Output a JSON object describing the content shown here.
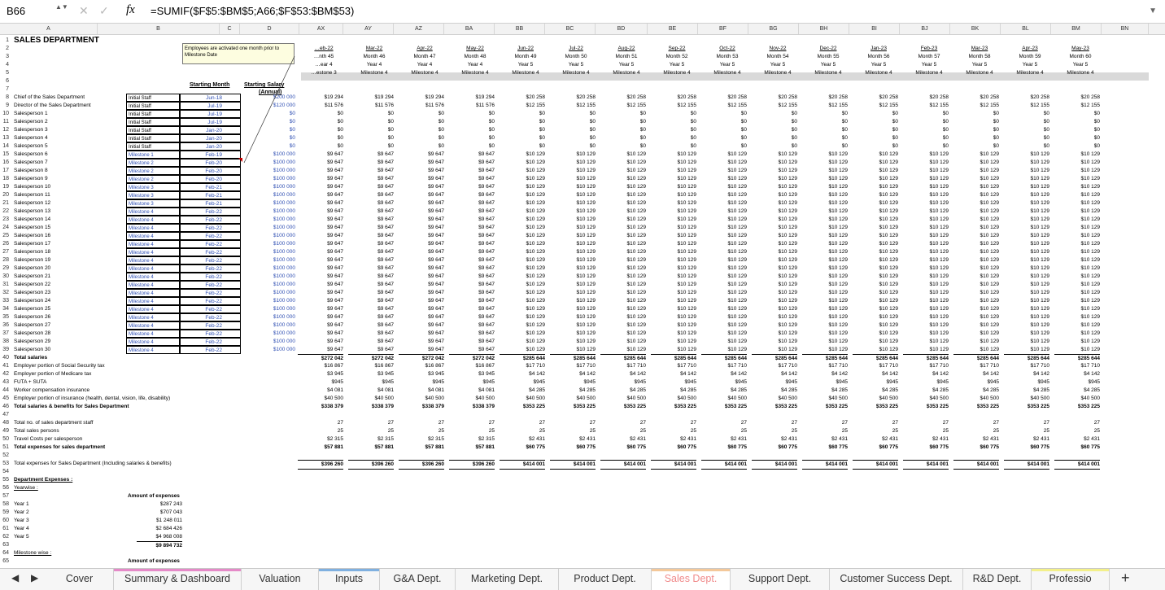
{
  "formula_bar": {
    "cell_ref": "B66",
    "fx": "fx",
    "formula": "=SUMIF($F$5:$BM$5;A66;$F$53:$BM$53)",
    "cancel": "✕",
    "confirm": "✓",
    "spin": "▲▼",
    "dropdown": "▼"
  },
  "columns": [
    "A",
    "B",
    "C",
    "D",
    "AX",
    "AY",
    "AZ",
    "BA",
    "BB",
    "BC",
    "BD",
    "BE",
    "BF",
    "BG",
    "BH",
    "BI",
    "BJ",
    "BK",
    "BL",
    "BM",
    "BN"
  ],
  "title": "SALES DEPARTMENT",
  "note": "Employees are activated one month prior to Milestone Date",
  "headers": {
    "starting_month": "Starting Month",
    "starting_salary": "Starting Salary",
    "annual": "(Annual)"
  },
  "months": [
    {
      "m": "…eb-22",
      "n": "…nth 45",
      "y": "…ear 4",
      "s": "…estone 3"
    },
    {
      "m": "Mar-22",
      "n": "Month 46",
      "y": "Year 4",
      "s": "Milestone 4"
    },
    {
      "m": "Apr-22",
      "n": "Month 47",
      "y": "Year 4",
      "s": "Milestone 4"
    },
    {
      "m": "May-22",
      "n": "Month 48",
      "y": "Year 4",
      "s": "Milestone 4"
    },
    {
      "m": "Jun-22",
      "n": "Month 49",
      "y": "Year 5",
      "s": "Milestone 4"
    },
    {
      "m": "Jul-22",
      "n": "Month 50",
      "y": "Year 5",
      "s": "Milestone 4"
    },
    {
      "m": "Aug-22",
      "n": "Month 51",
      "y": "Year 5",
      "s": "Milestone 4"
    },
    {
      "m": "Sep-22",
      "n": "Month 52",
      "y": "Year 5",
      "s": "Milestone 4"
    },
    {
      "m": "Oct-22",
      "n": "Month 53",
      "y": "Year 5",
      "s": "Milestone 4"
    },
    {
      "m": "Nov-22",
      "n": "Month 54",
      "y": "Year 5",
      "s": "Milestone 4"
    },
    {
      "m": "Dec-22",
      "n": "Month 55",
      "y": "Year 5",
      "s": "Milestone 4"
    },
    {
      "m": "Jan-23",
      "n": "Month 56",
      "y": "Year 5",
      "s": "Milestone 4"
    },
    {
      "m": "Feb-23",
      "n": "Month 57",
      "y": "Year 5",
      "s": "Milestone 4"
    },
    {
      "m": "Mar-23",
      "n": "Month 58",
      "y": "Year 5",
      "s": "Milestone 4"
    },
    {
      "m": "Apr-23",
      "n": "Month 59",
      "y": "Year 5",
      "s": "Milestone 4"
    },
    {
      "m": "May-23",
      "n": "Month 60",
      "y": "Year 5",
      "s": "Milestone 4"
    }
  ],
  "staff": [
    {
      "label": "Chief of the Sales Department",
      "cat": "Initial Staff",
      "date": "Jun-18",
      "sal": "$200 000",
      "yr4": "$19 294",
      "yr5": "$20 258"
    },
    {
      "label": "Director of the Sales Department",
      "cat": "Initial Staff",
      "date": "Jul-19",
      "sal": "$120 000",
      "yr4": "$11 576",
      "yr5": "$12 155"
    },
    {
      "label": "Salesperson 1",
      "cat": "Initial Staff",
      "date": "Jul-19",
      "sal": "$0",
      "yr4": "$0",
      "yr5": "$0"
    },
    {
      "label": "Salesperson 2",
      "cat": "Initial Staff",
      "date": "Jul-19",
      "sal": "$0",
      "yr4": "$0",
      "yr5": "$0"
    },
    {
      "label": "Salesperson 3",
      "cat": "Initial Staff",
      "date": "Jan-20",
      "sal": "$0",
      "yr4": "$0",
      "yr5": "$0"
    },
    {
      "label": "Salesperson 4",
      "cat": "Initial Staff",
      "date": "Jan-20",
      "sal": "$0",
      "yr4": "$0",
      "yr5": "$0"
    },
    {
      "label": "Salesperson 5",
      "cat": "Initial Staff",
      "date": "Jan-20",
      "sal": "$0",
      "yr4": "$0",
      "yr5": "$0"
    },
    {
      "label": "Salesperson 6",
      "cat": "Milestone 1",
      "date": "Feb-19",
      "sal": "$100 000",
      "yr4": "$9 647",
      "yr5": "$10 129"
    },
    {
      "label": "Salesperson 7",
      "cat": "Milestone 2",
      "date": "Feb-20",
      "sal": "$100 000",
      "yr4": "$9 647",
      "yr5": "$10 129"
    },
    {
      "label": "Salesperson 8",
      "cat": "Milestone 2",
      "date": "Feb-20",
      "sal": "$100 000",
      "yr4": "$9 647",
      "yr5": "$10 129"
    },
    {
      "label": "Salesperson 9",
      "cat": "Milestone 2",
      "date": "Feb-20",
      "sal": "$100 000",
      "yr4": "$9 647",
      "yr5": "$10 129"
    },
    {
      "label": "Salesperson 10",
      "cat": "Milestone 3",
      "date": "Feb-21",
      "sal": "$100 000",
      "yr4": "$9 647",
      "yr5": "$10 129"
    },
    {
      "label": "Salesperson 11",
      "cat": "Milestone 3",
      "date": "Feb-21",
      "sal": "$100 000",
      "yr4": "$9 647",
      "yr5": "$10 129"
    },
    {
      "label": "Salesperson 12",
      "cat": "Milestone 3",
      "date": "Feb-21",
      "sal": "$100 000",
      "yr4": "$9 647",
      "yr5": "$10 129"
    },
    {
      "label": "Salesperson 13",
      "cat": "Milestone 4",
      "date": "Feb-22",
      "sal": "$100 000",
      "yr4": "$9 647",
      "yr5": "$10 129"
    },
    {
      "label": "Salesperson 14",
      "cat": "Milestone 4",
      "date": "Feb-22",
      "sal": "$100 000",
      "yr4": "$9 647",
      "yr5": "$10 129"
    },
    {
      "label": "Salesperson 15",
      "cat": "Milestone 4",
      "date": "Feb-22",
      "sal": "$100 000",
      "yr4": "$9 647",
      "yr5": "$10 129"
    },
    {
      "label": "Salesperson 16",
      "cat": "Milestone 4",
      "date": "Feb-22",
      "sal": "$100 000",
      "yr4": "$9 647",
      "yr5": "$10 129"
    },
    {
      "label": "Salesperson 17",
      "cat": "Milestone 4",
      "date": "Feb-22",
      "sal": "$100 000",
      "yr4": "$9 647",
      "yr5": "$10 129"
    },
    {
      "label": "Salesperson 18",
      "cat": "Milestone 4",
      "date": "Feb-22",
      "sal": "$100 000",
      "yr4": "$9 647",
      "yr5": "$10 129"
    },
    {
      "label": "Salesperson 19",
      "cat": "Milestone 4",
      "date": "Feb-22",
      "sal": "$100 000",
      "yr4": "$9 647",
      "yr5": "$10 129"
    },
    {
      "label": "Salesperson 20",
      "cat": "Milestone 4",
      "date": "Feb-22",
      "sal": "$100 000",
      "yr4": "$9 647",
      "yr5": "$10 129"
    },
    {
      "label": "Salesperson 21",
      "cat": "Milestone 4",
      "date": "Feb-22",
      "sal": "$100 000",
      "yr4": "$9 647",
      "yr5": "$10 129"
    },
    {
      "label": "Salesperson 22",
      "cat": "Milestone 4",
      "date": "Feb-22",
      "sal": "$100 000",
      "yr4": "$9 647",
      "yr5": "$10 129"
    },
    {
      "label": "Salesperson 23",
      "cat": "Milestone 4",
      "date": "Feb-22",
      "sal": "$100 000",
      "yr4": "$9 647",
      "yr5": "$10 129"
    },
    {
      "label": "Salesperson 24",
      "cat": "Milestone 4",
      "date": "Feb-22",
      "sal": "$100 000",
      "yr4": "$9 647",
      "yr5": "$10 129"
    },
    {
      "label": "Salesperson 25",
      "cat": "Milestone 4",
      "date": "Feb-22",
      "sal": "$100 000",
      "yr4": "$9 647",
      "yr5": "$10 129"
    },
    {
      "label": "Salesperson 26",
      "cat": "Milestone 4",
      "date": "Feb-22",
      "sal": "$100 000",
      "yr4": "$9 647",
      "yr5": "$10 129"
    },
    {
      "label": "Salesperson 27",
      "cat": "Milestone 4",
      "date": "Feb-22",
      "sal": "$100 000",
      "yr4": "$9 647",
      "yr5": "$10 129"
    },
    {
      "label": "Salesperson 28",
      "cat": "Milestone 4",
      "date": "Feb-22",
      "sal": "$100 000",
      "yr4": "$9 647",
      "yr5": "$10 129"
    },
    {
      "label": "Salesperson 29",
      "cat": "Milestone 4",
      "date": "Feb-22",
      "sal": "$100 000",
      "yr4": "$9 647",
      "yr5": "$10 129"
    },
    {
      "label": "Salesperson 30",
      "cat": "Milestone 4",
      "date": "Feb-22",
      "sal": "$100 000",
      "yr4": "$9 647",
      "yr5": "$10 129"
    }
  ],
  "totals": [
    {
      "label": "Total salaries",
      "bold": true,
      "yr4": "$272 042",
      "yr5": "$285 644"
    },
    {
      "label": "Employer portion of Social Security tax",
      "bold": false,
      "yr4": "$16 867",
      "yr5": "$17 710"
    },
    {
      "label": "Employer portion of Medicare tax",
      "bold": false,
      "yr4": "$3 945",
      "yr5": "$4 142"
    },
    {
      "label": "FUTA + SUTA",
      "bold": false,
      "yr4": "$945",
      "yr5": "$945"
    },
    {
      "label": "Worker compensation insurance",
      "bold": false,
      "yr4": "$4 081",
      "yr5": "$4 285"
    },
    {
      "label": "Employer portion of insurance (health, dental, vision, life, disability)",
      "bold": false,
      "yr4": "$40 500",
      "yr5": "$40 500"
    },
    {
      "label": "Total salaries & benefits for Sales Department",
      "bold": true,
      "yr4": "$338 379",
      "yr5": "$353 225"
    }
  ],
  "staff_summary": [
    {
      "label": "Total no. of sales department staff",
      "bold": false,
      "yr4": "27",
      "yr5": "27"
    },
    {
      "label": "Total sales persons",
      "bold": false,
      "yr4": "25",
      "yr5": "25"
    },
    {
      "label": "Travel Costs per salesperson",
      "bold": false,
      "yr4": "$2 315",
      "yr5": "$2 431"
    },
    {
      "label": "Total expenses for sales department",
      "bold": true,
      "yr4": "$57 881",
      "yr5": "$60 775"
    }
  ],
  "total_expenses": {
    "label": "Total expenses for Sales Department  (Including salaries & benefits)",
    "yr4": "$396 260",
    "yr5": "$414 001"
  },
  "dept_expenses": {
    "heading": "Department Expenses :",
    "yearwise": "Yearwise :",
    "amount_heading": "Amount of expenses",
    "years": [
      {
        "label": "Year 1",
        "value": "$287 243"
      },
      {
        "label": "Year 2",
        "value": "$707 043"
      },
      {
        "label": "Year 3",
        "value": "$1 248 011"
      },
      {
        "label": "Year 4",
        "value": "$2 684 426"
      },
      {
        "label": "Year 5",
        "value": "$4 968 008"
      }
    ],
    "grand_total": "$9 894 732",
    "milestone_wise": "Milestone wise :",
    "amount_heading2": "Amount of expenses"
  },
  "row_numbers": [
    "1",
    "2",
    "3",
    "4",
    "5",
    "6",
    "7",
    "8",
    "9",
    "10",
    "11",
    "12",
    "13",
    "14",
    "15",
    "16",
    "17",
    "18",
    "19",
    "20",
    "21",
    "22",
    "23",
    "24",
    "25",
    "26",
    "27",
    "28",
    "29",
    "30",
    "31",
    "32",
    "33",
    "34",
    "35",
    "36",
    "37",
    "38",
    "39",
    "40",
    "41",
    "42",
    "43",
    "44",
    "45",
    "46",
    "47",
    "48",
    "49",
    "50",
    "51",
    "52",
    "53",
    "54",
    "55",
    "56",
    "57",
    "58",
    "59",
    "60",
    "61",
    "62",
    "63",
    "64",
    "65"
  ],
  "tabs": [
    {
      "label": "Cover",
      "color": ""
    },
    {
      "label": "Summary & Dashboard",
      "color": "#e58ac8"
    },
    {
      "label": "Valuation",
      "color": ""
    },
    {
      "label": "Inputs",
      "color": "#7fb0e0"
    },
    {
      "label": "G&A Dept.",
      "color": ""
    },
    {
      "label": "Marketing Dept.",
      "color": ""
    },
    {
      "label": "Product Dept.",
      "color": ""
    },
    {
      "label": "Sales Dept.",
      "color": "#f4c89a"
    },
    {
      "label": "Support Dept.",
      "color": ""
    },
    {
      "label": "Customer Success Dept.",
      "color": ""
    },
    {
      "label": "R&D Dept.",
      "color": ""
    },
    {
      "label": "Professio",
      "color": "#f3f08a"
    }
  ],
  "nav": {
    "prev": "◀",
    "next": "▶",
    "add": "+"
  }
}
